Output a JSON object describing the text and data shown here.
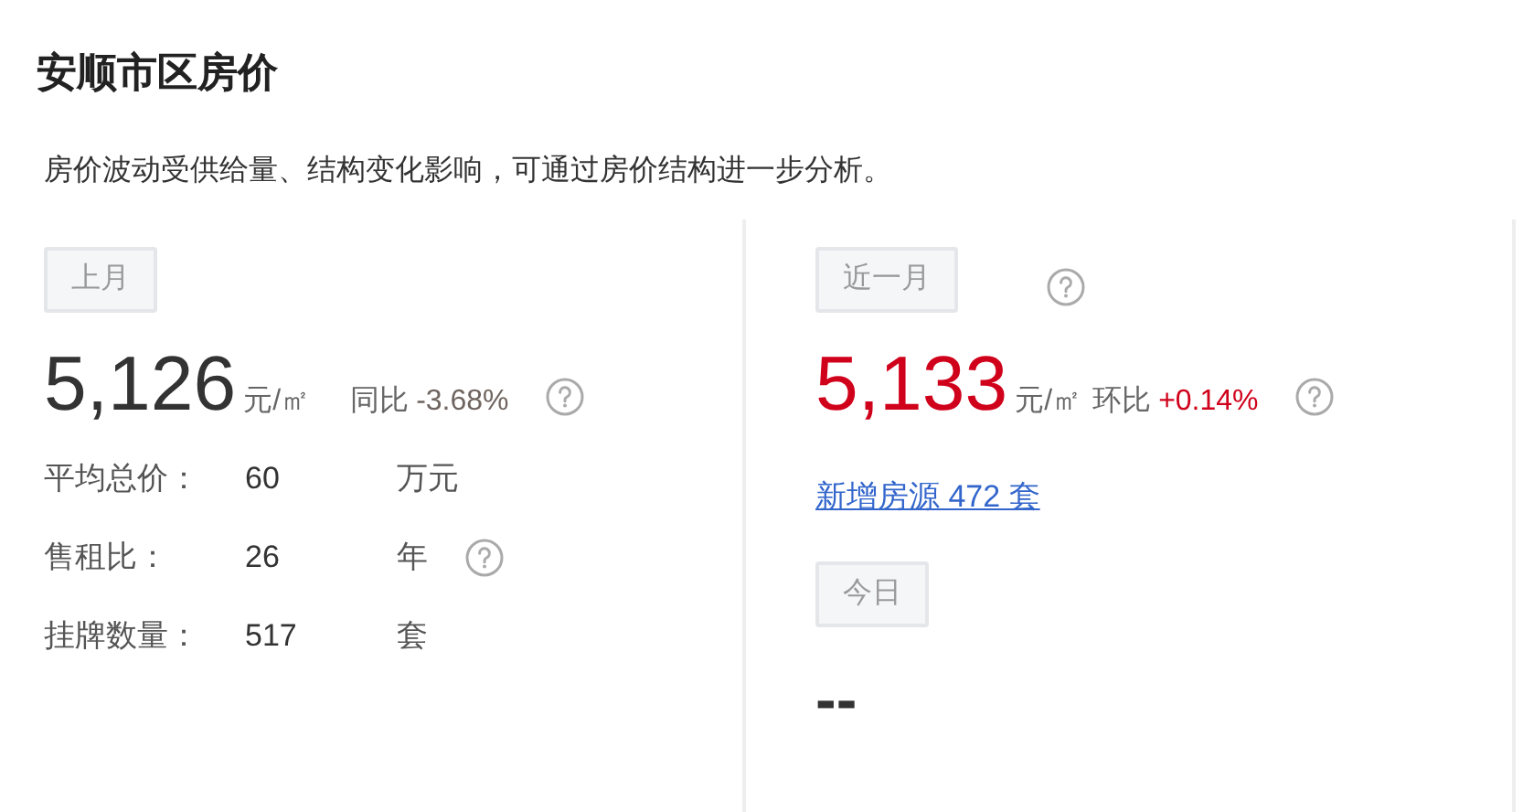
{
  "title": "安顺市区房价",
  "description": "房价波动受供给量、结构变化影响，可通过房价结构进一步分析。",
  "panels": [
    {
      "tag": "上月",
      "tag_help": false,
      "price": "5,126",
      "unit": "元/㎡",
      "change_label": "同比",
      "change_value": "-3.68%",
      "kind": "year_on_year",
      "change_help": true,
      "stats": [
        {
          "label": "平均总价：",
          "value": "60",
          "unit": "万元",
          "help": false
        },
        {
          "label": "售租比：",
          "value": "26",
          "unit": "年",
          "help": true
        },
        {
          "label": "挂牌数量：",
          "value": "517",
          "unit": "套",
          "help": false
        }
      ]
    },
    {
      "tag": "近一月",
      "tag_help": true,
      "price": "5,133",
      "unit": "元/㎡",
      "change_label": "环比",
      "change_value": "+0.14%",
      "kind": "month_on_month",
      "change_help": true,
      "link": "新增房源 472 套",
      "today": {
        "tag": "今日",
        "value": "--"
      }
    }
  ]
}
